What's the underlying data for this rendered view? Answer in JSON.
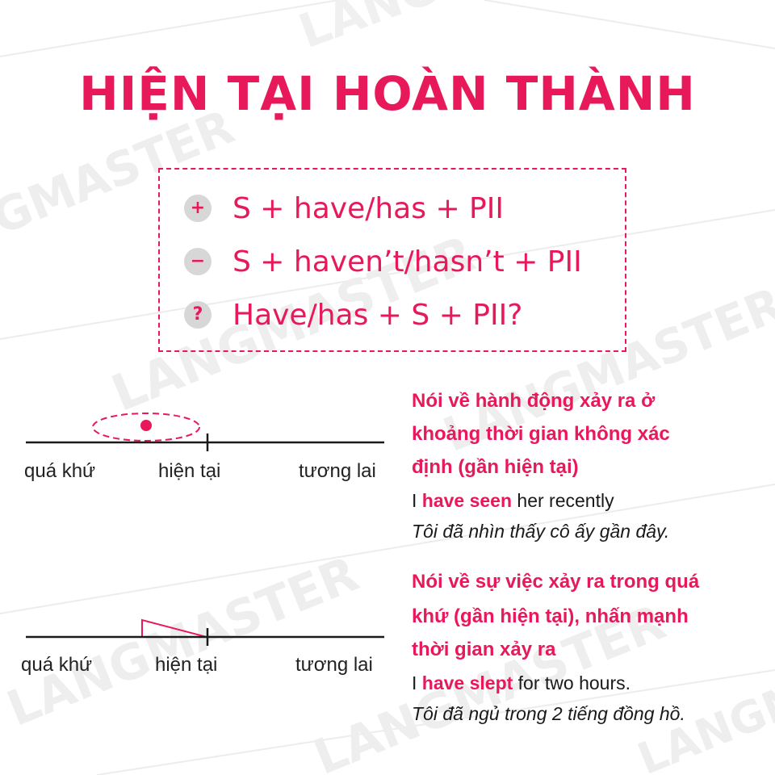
{
  "colors": {
    "accent": "#e8195a",
    "text": "#1a1a1a",
    "icon_bg": "#d7d7d7",
    "watermark": "#eeeeee"
  },
  "watermark": {
    "text": "LANGMASTER"
  },
  "title": "HIỆN TẠI HOÀN THÀNH",
  "formulas": [
    {
      "icon": "plus-icon",
      "symbol": "+",
      "text": "S + have/has + PII"
    },
    {
      "icon": "minus-icon",
      "symbol": "−",
      "text": "S + haven’t/hasn’t + PII"
    },
    {
      "icon": "question-icon",
      "symbol": "?",
      "text": "Have/has + S + PII?"
    }
  ],
  "timelines": [
    {
      "labels": {
        "past": "quá khứ",
        "present": "hiện tại",
        "future": "tương lai"
      }
    },
    {
      "labels": {
        "past": "quá khứ",
        "present": "hiện tại",
        "future": "tương lai"
      }
    }
  ],
  "usages": [
    {
      "heading_lines": [
        "Nói về hành động xảy ra ở",
        "khoảng thời gian không xác",
        "định (gần hiện tại)"
      ],
      "example": {
        "subject": "I",
        "verb": "have seen",
        "rest": "her recently"
      },
      "translation": "Tôi đã nhìn thấy cô ấy gần đây."
    },
    {
      "heading_lines": [
        "Nói về sự việc xảy ra trong quá",
        "khứ (gần hiện tại), nhấn mạnh",
        "thời gian xảy ra"
      ],
      "example": {
        "subject": "I",
        "verb": "have slept",
        "rest": "for two hours."
      },
      "translation": "Tôi đã ngủ trong 2 tiếng đồng hồ."
    }
  ]
}
